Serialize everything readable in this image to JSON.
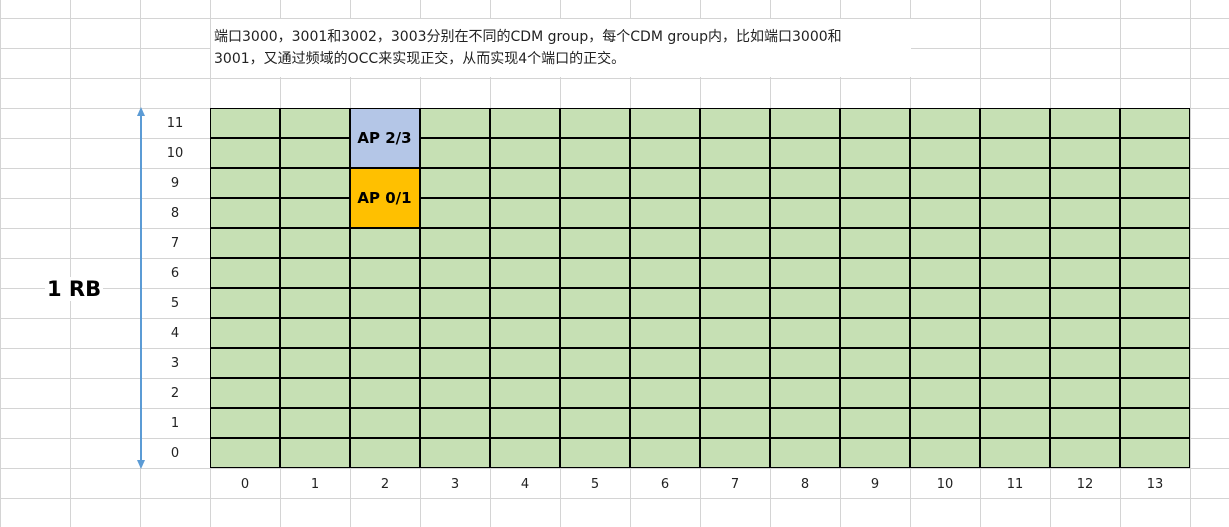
{
  "note": {
    "line1": "端口3000，3001和3002，3003分别在不同的CDM group，每个CDM group内，比如端口3000和",
    "line2": "3001，又通过频域的OCC来实现正交，从而实现4个端口的正交。"
  },
  "rb_label": "1 RB",
  "y_labels": [
    "11",
    "10",
    "9",
    "8",
    "7",
    "6",
    "5",
    "4",
    "3",
    "2",
    "1",
    "0"
  ],
  "x_labels": [
    "0",
    "1",
    "2",
    "3",
    "4",
    "5",
    "6",
    "7",
    "8",
    "9",
    "10",
    "11",
    "12",
    "13"
  ],
  "blocks": [
    {
      "label": "AP 2/3",
      "symbol": 2,
      "subcarriers": [
        10,
        11
      ],
      "color": "#b4c6e7"
    },
    {
      "label": "AP 0/1",
      "symbol": 2,
      "subcarriers": [
        8,
        9
      ],
      "color": "#ffc000"
    }
  ],
  "colors": {
    "re_fill": "#c6e0b4",
    "arrow": "#5b9bd5"
  }
}
